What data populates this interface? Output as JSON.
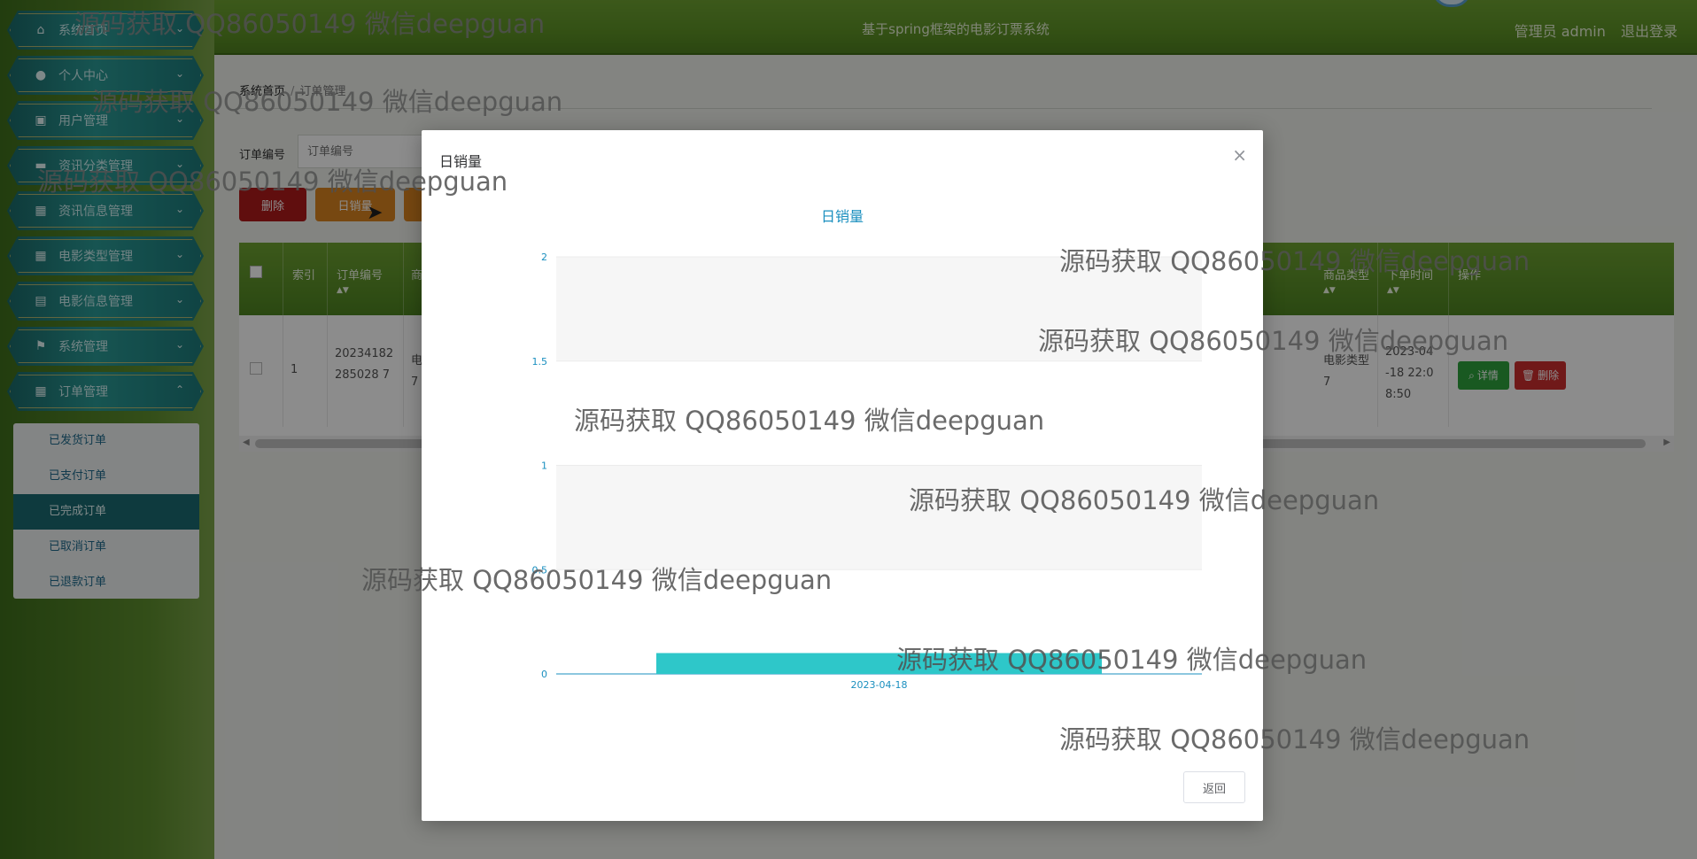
{
  "header": {
    "title": "基于spring框架的电影订票系统",
    "user_label": "管理员 admin",
    "logout_label": "退出登录"
  },
  "sidebar": {
    "items": [
      {
        "label": "系统首页",
        "icon": "home-icon"
      },
      {
        "label": "个人中心",
        "icon": "user-icon"
      },
      {
        "label": "用户管理",
        "icon": "briefcase-icon"
      },
      {
        "label": "资讯分类管理",
        "icon": "chat-icon"
      },
      {
        "label": "资讯信息管理",
        "icon": "grid-icon"
      },
      {
        "label": "电影类型管理",
        "icon": "grid-icon"
      },
      {
        "label": "电影信息管理",
        "icon": "clipboard-icon"
      },
      {
        "label": "系统管理",
        "icon": "flag-icon"
      },
      {
        "label": "订单管理",
        "icon": "grid-icon"
      }
    ],
    "submenu": [
      {
        "label": "已发货订单"
      },
      {
        "label": "已支付订单"
      },
      {
        "label": "已完成订单"
      },
      {
        "label": "已取消订单"
      },
      {
        "label": "已退款订单"
      }
    ]
  },
  "breadcrumb": {
    "home": "系统首页",
    "separator": "/",
    "current": "订单管理"
  },
  "search": {
    "label": "订单编号",
    "placeholder": "订单编号"
  },
  "toolbar": {
    "delete_label": "删除",
    "daily_label": "日销量"
  },
  "table": {
    "headers": {
      "index": "索引",
      "order_no": "订单编号",
      "product": "商",
      "product_type": "商品类型",
      "purchase_time": "下单时间",
      "actions": "操作"
    },
    "row": {
      "index": "1",
      "order_no": "20234182285028 7",
      "product": "电 7",
      "product_type": "电影类型 7",
      "purchase_time": "2023-04 -18 22:0 8:50",
      "detail_label": "详情",
      "delete_label": "删除"
    }
  },
  "modal": {
    "title": "日销量",
    "close_glyph": "×",
    "back_label": "返回"
  },
  "chart_data": {
    "type": "bar",
    "title": "日销量",
    "categories": [
      "2023-04-18"
    ],
    "values": [
      0.1
    ],
    "ylim": [
      0,
      2
    ],
    "yticks": [
      "0",
      "0.5",
      "1",
      "1.5",
      "2"
    ],
    "grid": true,
    "colors": {
      "bar": "#2ec7c9",
      "axis": "#1a8fbf",
      "band": "#f6f6f6"
    }
  },
  "watermark": {
    "text": "源码获取 QQ86050149 微信deepguan"
  },
  "colors": {
    "header_green": "#5e9326",
    "danger": "#b01a1a",
    "warning": "#d98320",
    "success": "#2ea33d",
    "teal": "#1b6b72"
  }
}
